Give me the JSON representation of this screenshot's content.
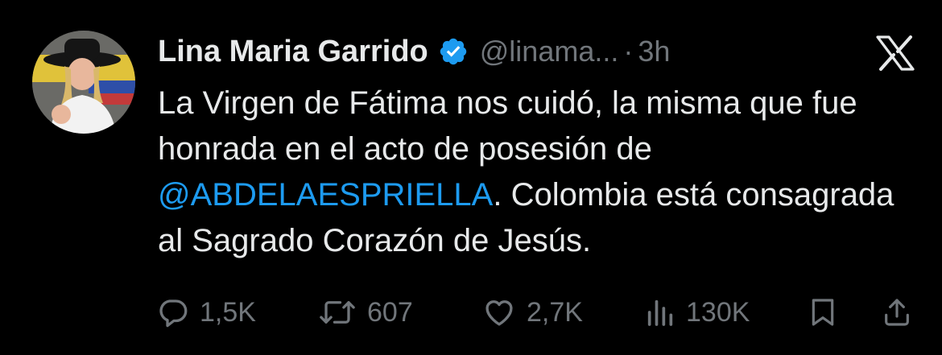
{
  "tweet": {
    "author": {
      "name": "Lina Maria Garrido",
      "handle": "@linama...",
      "verified_icon": "verified-badge-icon",
      "avatar_icon": "profile-avatar"
    },
    "separator": "·",
    "time": "3h",
    "platform_icon": "x-logo-icon",
    "text_part1": "La Virgen de Fátima nos cuidó, la misma que fue honrada en el acto de posesión de ",
    "mention": "@ABDELAESPRIELLA",
    "text_part2": ". Colombia está consagrada al Sagrado Corazón de Jesús."
  },
  "actions": {
    "replies": "1,5K",
    "reposts": "607",
    "likes": "2,7K",
    "views": "130K"
  },
  "colors": {
    "background": "#000000",
    "text": "#e7e9ea",
    "muted": "#71767b",
    "mention": "#1d9bf0",
    "verified": "#1d9bf0"
  }
}
